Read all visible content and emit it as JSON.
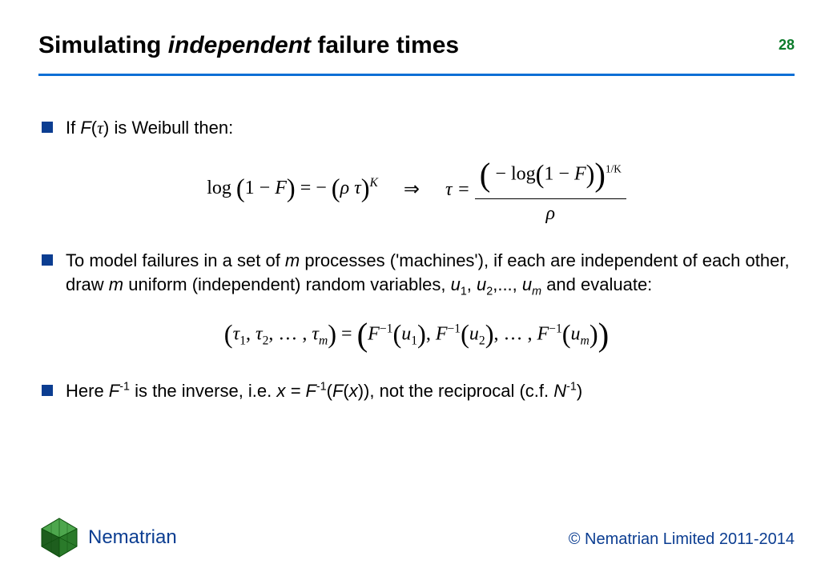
{
  "slide": {
    "number": "28",
    "title_prefix": "Simulating ",
    "title_italic": "independent",
    "title_suffix": " failure times"
  },
  "bullets": {
    "b1_prefix": "If ",
    "b1_F": "F",
    "b1_paren_open": "(",
    "b1_tau": "τ",
    "b1_paren_close": ")",
    "b1_rest": " is Weibull then:",
    "b2_a": "To model failures in a set of ",
    "b2_m1": "m",
    "b2_b": " processes ('machines'), if each are independent of each other, draw ",
    "b2_m2": "m",
    "b2_c": " uniform (independent) random variables, ",
    "b2_u1": "u",
    "b2_u1s": "1",
    "b2_comma1": ", ",
    "b2_u2": "u",
    "b2_u2s": "2",
    "b2_dots": ",..., ",
    "b2_um": "u",
    "b2_ums": "m",
    "b2_d": " and evaluate:",
    "b3_a": "Here ",
    "b3_F": "F",
    "b3_inv": "-1",
    "b3_b": " is the inverse, i.e. ",
    "b3_x1": "x = F",
    "b3_inv2": "-1",
    "b3_mid": "(",
    "b3_F2": "F",
    "b3_x2": "(",
    "b3_x3": "x",
    "b3_close": ")), not the reciprocal (c.f. ",
    "b3_N": "N",
    "b3_inv3": "-1",
    "b3_end": ")"
  },
  "eq1": {
    "log": "log",
    "lp1": "(",
    "one_minus_F": "1 − ",
    "F": "F",
    "rp1": ")",
    "eq_neg": " = − ",
    "lp2": "(",
    "rho": "ρ",
    "sp": " ",
    "tau": "τ",
    "rp2": ")",
    "K": "K",
    "arrow": "⇒",
    "tau_eq": "τ  =  ",
    "num_lp": "(",
    "num_neg": " − ",
    "num_log": "log",
    "num_lp2": "(",
    "num_1mF": "1 − ",
    "num_F": "F",
    "num_rp2": ")",
    "num_rp": ")",
    "exp_1overK": "1/K",
    "den_rho": "ρ"
  },
  "eq2": {
    "lp": "(",
    "tau": "τ",
    "s1": "1",
    "c": ", ",
    "s2": "2",
    "dots": ", … , ",
    "sm": "m",
    "rp": ")",
    "eqsign": " = ",
    "F": "F",
    "inv": "−1",
    "u": "u"
  },
  "footer": {
    "brand": "Nematrian",
    "copyright": "© Nematrian Limited 2011-2014"
  }
}
